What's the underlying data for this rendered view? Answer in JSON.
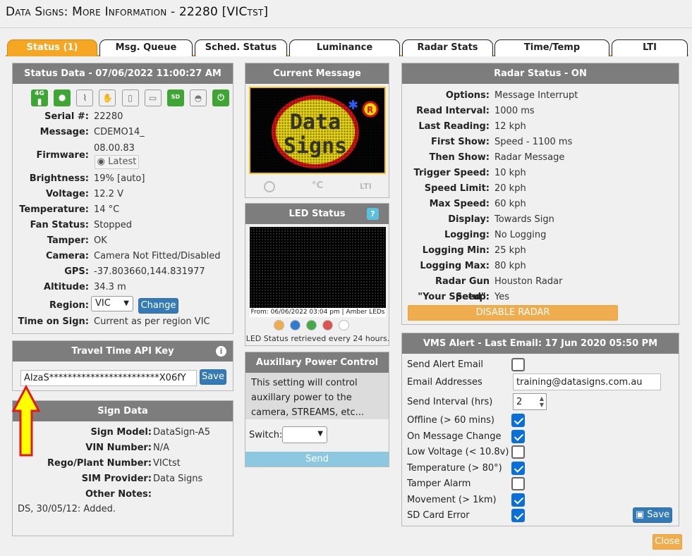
{
  "window": {
    "title": "Data Signs: More Information - 22280 [VICtst]"
  },
  "tabs": [
    "Status (1)",
    "Msg. Queue",
    "Sched. Status",
    "Luminance",
    "Radar Stats",
    "Time/Temp",
    "LTI"
  ],
  "status_data": {
    "header": "Status Data - 07/06/2022 11:00:27 AM",
    "icons": [
      "signal-4g-icon",
      "location-pin-icon",
      "route-icon",
      "hand-icon",
      "thermometer-icon",
      "battery-icon",
      "sd-card-icon",
      "camera-dome-icon",
      "power-icon"
    ],
    "icon_text": {
      "sd": "SD",
      "four_g": "4G"
    },
    "rows": [
      {
        "label": "Serial #:",
        "value": "22280"
      },
      {
        "label": "Message:",
        "value": "CDEMO14_"
      },
      {
        "label": "Firmware:",
        "value": "08.00.83"
      },
      {
        "label": "Brightness:",
        "value": "19% [auto]"
      },
      {
        "label": "Voltage:",
        "value": "12.2 V"
      },
      {
        "label": "Temperature:",
        "value": "14 °C"
      },
      {
        "label": "Fan Status:",
        "value": "Stopped"
      },
      {
        "label": "Tamper:",
        "value": "OK"
      },
      {
        "label": "Camera:",
        "value": "Camera Not Fitted/Disabled"
      },
      {
        "label": "GPS:",
        "value": "-37.803660,144.831977"
      },
      {
        "label": "Altitude:",
        "value": "34.3 m"
      },
      {
        "label": "Region:",
        "value": "VIC"
      },
      {
        "label": "Time on Sign:",
        "value": "Current as per region VIC"
      }
    ],
    "firmware_badge": "Latest",
    "region_change": "Change"
  },
  "travel_time": {
    "header": "Travel Time API Key",
    "key_value": "AIzaS************************X06fY",
    "save": "Save"
  },
  "sign_data": {
    "header": "Sign Data",
    "rows": [
      {
        "label": "Sign Model:",
        "value": "DataSign-A5"
      },
      {
        "label": "VIN Number:",
        "value": "N/A"
      },
      {
        "label": "Rego/Plant Number:",
        "value": "VICtst"
      },
      {
        "label": "SIM Provider:",
        "value": "Data Signs"
      },
      {
        "label": "Other Notes:",
        "value": ""
      }
    ],
    "notes": "DS, 30/05/12: Added."
  },
  "current_message": {
    "header": "Current Message",
    "logo_text": [
      "Data",
      "Signs"
    ],
    "footer_icons": [
      "clock-icon",
      "celsius-icon",
      "lti-icon"
    ],
    "footer_text": [
      "",
      "°C",
      "LTI"
    ]
  },
  "led_status": {
    "header": "LED Status",
    "caption": "From: 06/06/2022 03:04 pm | Amber LEDs",
    "dots": [
      "#f0ad4e",
      "#2e7bcf",
      "#46a846",
      "#d9534f",
      "#ffffff"
    ],
    "note": "LED Status retrieved every 24 hours."
  },
  "aux_power": {
    "header": "Auxillary Power Control",
    "desc": "This setting will control auxillary power to the camera, STREAMS, etc...",
    "switch_label": "Switch:",
    "send": "Send"
  },
  "radar_status": {
    "header": "Radar Status - ON",
    "rows": [
      {
        "label": "Options:",
        "value": "Message Interrupt"
      },
      {
        "label": "Read Interval:",
        "value": "1000 ms"
      },
      {
        "label": "Last Reading:",
        "value": "12 kph"
      },
      {
        "label": "First Show:",
        "value": "Speed - 1100 ms"
      },
      {
        "label": "Then Show:",
        "value": "Radar Message"
      },
      {
        "label": "Trigger Speed:",
        "value": "10 kph"
      },
      {
        "label": "Speed Limit:",
        "value": "20 kph"
      },
      {
        "label": "Max Speed:",
        "value": "60 kph"
      },
      {
        "label": "Display:",
        "value": "Towards Sign"
      },
      {
        "label": "Logging:",
        "value": "No Logging"
      },
      {
        "label": "Logging Min:",
        "value": "25 kph"
      },
      {
        "label": "Logging Max:",
        "value": "80 kph"
      },
      {
        "label": "Radar Gun Setup:",
        "value": "Houston Radar"
      },
      {
        "label": "\"Your Speed\":",
        "value": "Yes"
      }
    ],
    "disable_button": "DISABLE RADAR"
  },
  "vms_alert": {
    "header": "VMS Alert - Last Email: 17 Jun 2020 05:50 PM",
    "send_alert_label": "Send Alert Email",
    "send_alert_checked": false,
    "email_label": "Email Addresses",
    "email_value": "training@datasigns.com.au",
    "interval_label": "Send Interval (hrs)",
    "interval_value": "2",
    "alerts": [
      {
        "label": "Offline (> 60 mins)",
        "checked": true
      },
      {
        "label": "On Message Change",
        "checked": true
      },
      {
        "label": "Low Voltage (< 10.8v)",
        "checked": false
      },
      {
        "label": "Temperature (> 80°)",
        "checked": true
      },
      {
        "label": "Tamper Alarm",
        "checked": false
      },
      {
        "label": "Movement (> 1km)",
        "checked": true
      },
      {
        "label": "SD Card Error",
        "checked": true
      }
    ],
    "save": "Save"
  },
  "close_button": "Close",
  "colors": {
    "accent_orange": "#f5a623",
    "header_grey": "#7d7d7d",
    "button_blue": "#337ab7",
    "arrow_yellow": "#ffff00",
    "arrow_red": "#e01b1b"
  }
}
